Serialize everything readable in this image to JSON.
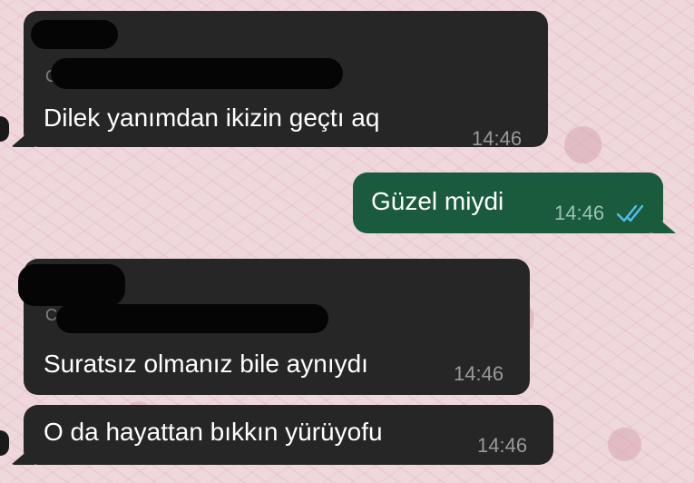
{
  "colors": {
    "incoming_bubble": "#262626",
    "outgoing_bubble": "#1a5a3d",
    "read_ticks": "#53bdeb",
    "wallpaper": "#efd8dc"
  },
  "messages": [
    {
      "direction": "incoming",
      "reply_preview_prefix": "C",
      "text": "Dilek yanımdan ikizin geçtı aq",
      "time": "14:46",
      "sender_redacted": true
    },
    {
      "direction": "outgoing",
      "text": "Güzel miydi",
      "time": "14:46",
      "status_icon": "double-check-read-icon"
    },
    {
      "direction": "incoming",
      "reply_preview_prefix": "C",
      "text": "Suratsız olmanız bile aynıydı",
      "time": "14:46",
      "sender_redacted": true
    },
    {
      "direction": "incoming",
      "text": "O da hayattan bıkkın yürüyofu",
      "time": "14:46"
    }
  ]
}
